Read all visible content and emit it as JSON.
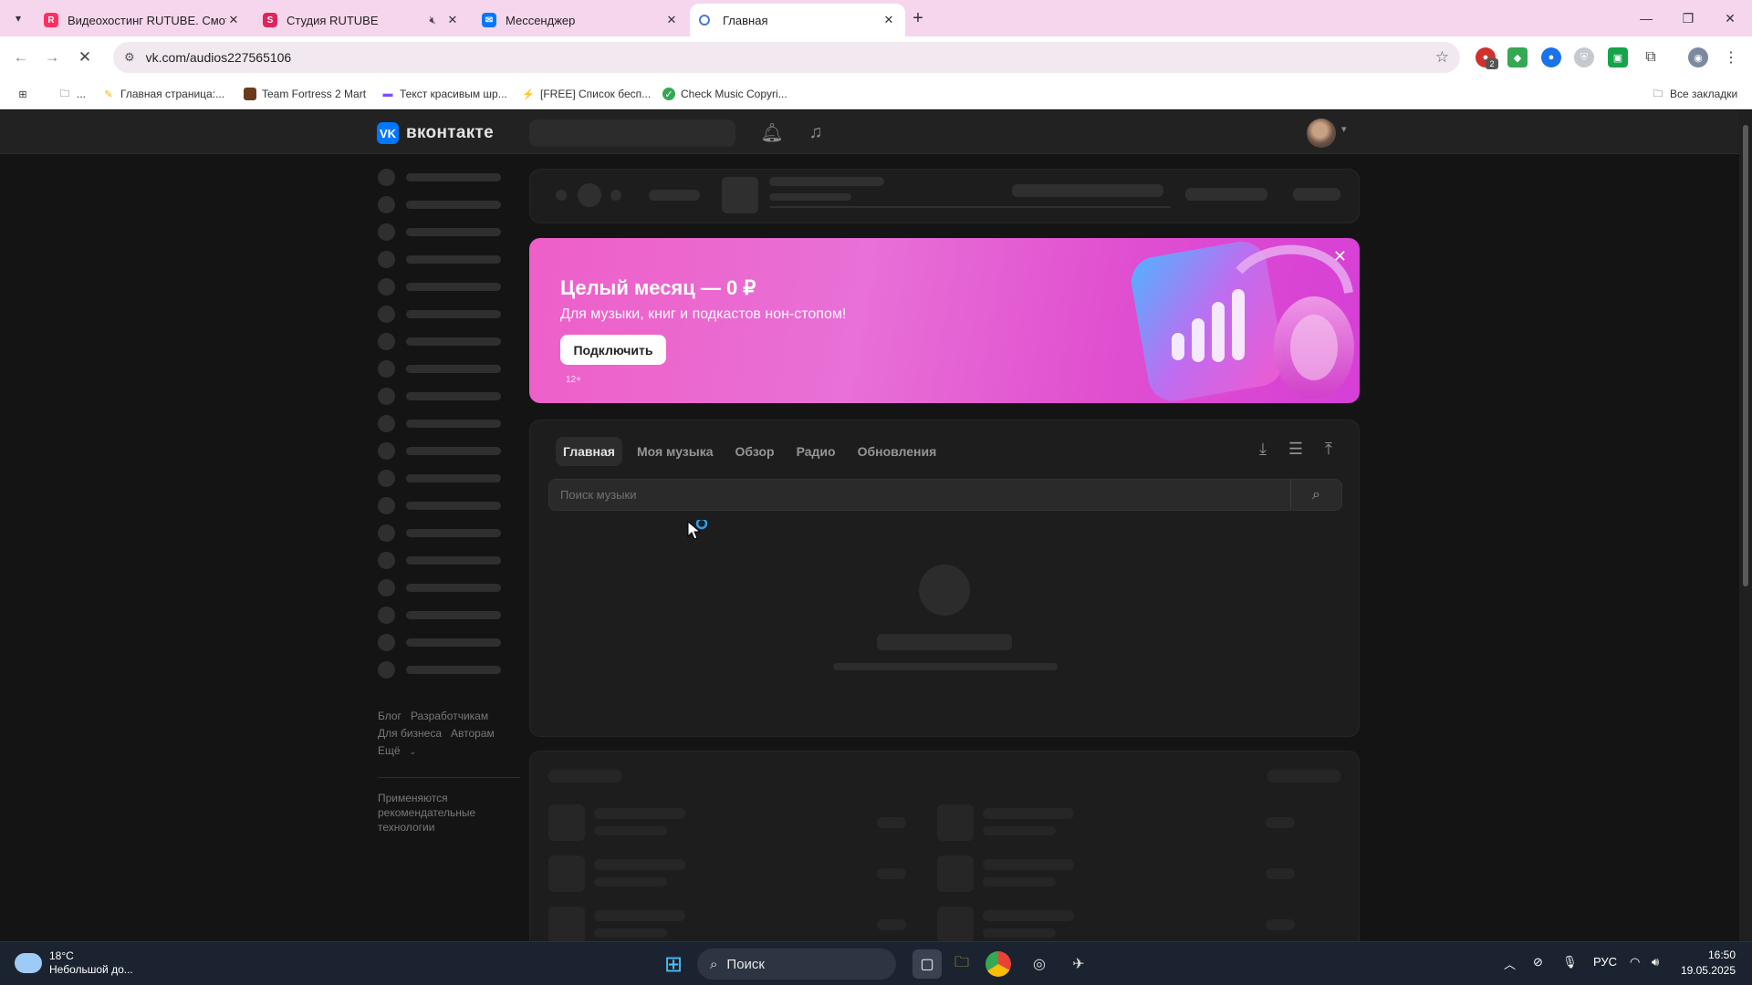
{
  "browser": {
    "tabs": [
      {
        "title": "Видеохостинг RUTUBE. Смотрі",
        "favicon": "rutube-icon",
        "color": "#ff2e63",
        "active": false
      },
      {
        "title": "Студия RUTUBE",
        "favicon": "rutube-studio-icon",
        "color": "#e0245e",
        "active": false,
        "muted": true
      },
      {
        "title": "Мессенджер",
        "favicon": "vk-icon",
        "color": "#0077ff",
        "active": false
      },
      {
        "title": "Главная",
        "favicon": "loading-icon",
        "color": "#4a7bd6",
        "active": true
      }
    ],
    "url": "vk.com/audios227565106",
    "bookmarks": [
      {
        "label": "...",
        "icon": "folder-icon"
      },
      {
        "label": "Главная страница:...",
        "icon": "bookmark-icon"
      },
      {
        "label": "Team Fortress 2 Mart",
        "icon": "bookmark-icon"
      },
      {
        "label": "Текст красивым шр...",
        "icon": "bookmark-icon"
      },
      {
        "label": "[FREE] Список бесп...",
        "icon": "bookmark-icon"
      },
      {
        "label": "Check Music Copyri...",
        "icon": "check-icon"
      }
    ],
    "all_bookmarks": "Все закладки",
    "extension_badge": "2"
  },
  "vk": {
    "logo_text": "вконтакте",
    "banner": {
      "title": "Целый месяц — 0 ₽",
      "subtitle": "Для музыки, книг и подкастов нон-стопом!",
      "button": "Подключить",
      "age": "12+"
    },
    "music_tabs": [
      {
        "label": "Главная",
        "selected": true
      },
      {
        "label": "Моя музыка",
        "selected": false
      },
      {
        "label": "Обзор",
        "selected": false
      },
      {
        "label": "Радио",
        "selected": false
      },
      {
        "label": "Обновления",
        "selected": false
      }
    ],
    "search_placeholder": "Поиск музыки",
    "footer": {
      "links": [
        "Блог",
        "Разработчикам",
        "Для бизнеса",
        "Авторам",
        "Ещё"
      ],
      "note": "Применяются рекомендательные технологии"
    }
  },
  "taskbar": {
    "weather_temp": "18°C",
    "weather_text": "Небольшой до...",
    "search_label": "Поиск",
    "lang": "РУС",
    "time": "16:50",
    "date": "19.05.2025"
  }
}
